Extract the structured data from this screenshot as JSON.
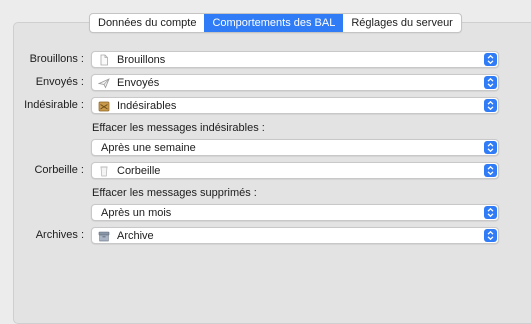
{
  "tabs": [
    {
      "label": "Données du compte",
      "active": false
    },
    {
      "label": "Comportements des BAL",
      "active": true
    },
    {
      "label": "Réglages du serveur",
      "active": false
    }
  ],
  "rows": {
    "drafts": {
      "label": "Brouillons :",
      "value": "Brouillons",
      "icon": "document-icon"
    },
    "sent": {
      "label": "Envoyés :",
      "value": "Envoyés",
      "icon": "paper-plane-icon"
    },
    "junk": {
      "label": "Indésirable :",
      "value": "Indésirables",
      "icon": "junk-mailbox-icon"
    },
    "junk_erase_label": "Effacer les messages indésirables :",
    "junk_erase_value": "Après une semaine",
    "trash": {
      "label": "Corbeille :",
      "value": "Corbeille",
      "icon": "trash-icon"
    },
    "trash_erase_label": "Effacer les messages supprimés :",
    "trash_erase_value": "Après un mois",
    "archive": {
      "label": "Archives :",
      "value": "Archive",
      "icon": "archive-box-icon"
    }
  },
  "colors": {
    "accent": "#2f7cf6",
    "panel": "#e3e3e3",
    "window": "#ececec"
  }
}
